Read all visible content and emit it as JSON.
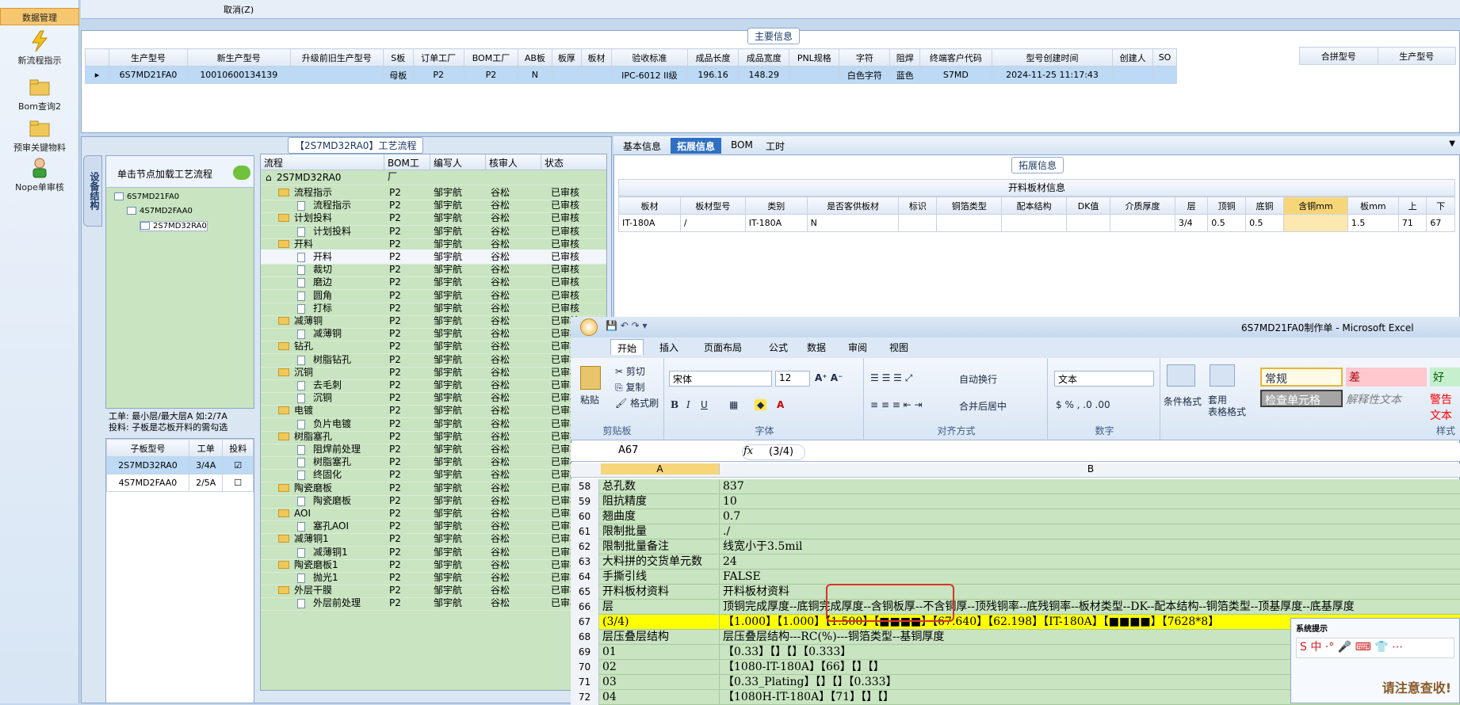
{
  "left_nav": {
    "items": [
      {
        "label": "数据管理",
        "icon": "database-icon",
        "active": true
      },
      {
        "label": "新流程指示",
        "icon": "lightning-icon"
      },
      {
        "label": "Bom查询2",
        "icon": "folder-open-icon"
      },
      {
        "label": "预审关键物料",
        "icon": "folder-open-icon"
      },
      {
        "label": "Nope单审核",
        "icon": "user-icon"
      }
    ]
  },
  "topbar": {
    "cancel_label": "取消(Z)"
  },
  "main_info": {
    "title": "主要信息",
    "columns": [
      "生产型号",
      "新生产型号",
      "升级前旧生产型号",
      "S板",
      "订单工厂",
      "BOM工厂",
      "AB板",
      "板厚",
      "板材",
      "验收标准",
      "成品长度",
      "成品宽度",
      "PNL规格",
      "字符",
      "阻焊",
      "终端客户代码",
      "型号创建时间",
      "创建人",
      "SO"
    ],
    "row": [
      "6S7MD21FA0",
      "10010600134139",
      "",
      "母板",
      "P2",
      "P2",
      "N",
      "",
      "",
      "IPC-6012 II级",
      "196.16",
      "148.29",
      "",
      "白色字符",
      "蓝色",
      "S7MD",
      "2024-11-25 11:17:43",
      "",
      ""
    ],
    "side_columns": [
      "合拼型号",
      "生产型号"
    ]
  },
  "process": {
    "title": "【2S7MD32RA0】工艺流程",
    "vertical_tab": "设备结构",
    "tree_header": "单击节点加载工艺流程",
    "tree_nodes": [
      "6S7MD21FA0",
      "4S7MD2FAA0",
      "2S7MD32RA0"
    ],
    "info_line1": "工单: 最小层/最大层A 如:2/7A",
    "info_line2": "投料: 子板是芯板开料的需勾选",
    "child_columns": [
      "子板型号",
      "工单",
      "投料"
    ],
    "child_rows": [
      {
        "model": "2S7MD32RA0",
        "order": "3/4A",
        "checked": true
      },
      {
        "model": "4S7MD2FAA0",
        "order": "2/5A",
        "checked": false
      }
    ],
    "flow_columns": [
      "流程",
      "BOM工厂",
      "编写人",
      "核审人",
      "状态"
    ],
    "flow_root": "2S7MD32RA0",
    "flow_rows": [
      {
        "name": "流程指示",
        "type": "folder",
        "f": "P2",
        "w": "邹宇航",
        "r": "谷松",
        "s": "已审核"
      },
      {
        "name": "流程指示",
        "type": "doc",
        "f": "P2",
        "w": "邹宇航",
        "r": "谷松",
        "s": "已审核"
      },
      {
        "name": "计划投料",
        "type": "folder",
        "f": "P2",
        "w": "邹宇航",
        "r": "谷松",
        "s": "已审核"
      },
      {
        "name": "计划投料",
        "type": "doc",
        "f": "P2",
        "w": "邹宇航",
        "r": "谷松",
        "s": "已审核"
      },
      {
        "name": "开料",
        "type": "folder",
        "f": "P2",
        "w": "邹宇航",
        "r": "谷松",
        "s": "已审核"
      },
      {
        "name": "开料",
        "type": "doc",
        "f": "P2",
        "w": "邹宇航",
        "r": "谷松",
        "s": "已审核"
      },
      {
        "name": "裁切",
        "type": "doc",
        "f": "P2",
        "w": "邹宇航",
        "r": "谷松",
        "s": "已审核"
      },
      {
        "name": "磨边",
        "type": "doc",
        "f": "P2",
        "w": "邹宇航",
        "r": "谷松",
        "s": "已审核"
      },
      {
        "name": "圆角",
        "type": "doc",
        "f": "P2",
        "w": "邹宇航",
        "r": "谷松",
        "s": "已审核"
      },
      {
        "name": "打标",
        "type": "doc",
        "f": "P2",
        "w": "邹宇航",
        "r": "谷松",
        "s": "已审核"
      },
      {
        "name": "减薄铜",
        "type": "folder",
        "f": "P2",
        "w": "邹宇航",
        "r": "谷松",
        "s": "已审核"
      },
      {
        "name": "减薄铜",
        "type": "doc",
        "f": "P2",
        "w": "邹宇航",
        "r": "谷松",
        "s": "已审核"
      },
      {
        "name": "钻孔",
        "type": "folder",
        "f": "P2",
        "w": "邹宇航",
        "r": "谷松",
        "s": "已审核"
      },
      {
        "name": "树脂钻孔",
        "type": "doc",
        "f": "P2",
        "w": "邹宇航",
        "r": "谷松",
        "s": "已审核"
      },
      {
        "name": "沉铜",
        "type": "folder",
        "f": "P2",
        "w": "邹宇航",
        "r": "谷松",
        "s": "已审核"
      },
      {
        "name": "去毛刺",
        "type": "doc",
        "f": "P2",
        "w": "邹宇航",
        "r": "谷松",
        "s": "已审核"
      },
      {
        "name": "沉铜",
        "type": "doc",
        "f": "P2",
        "w": "邹宇航",
        "r": "谷松",
        "s": "已审核"
      },
      {
        "name": "电镀",
        "type": "folder",
        "f": "P2",
        "w": "邹宇航",
        "r": "谷松",
        "s": "已审核"
      },
      {
        "name": "负片电镀",
        "type": "doc",
        "f": "P2",
        "w": "邹宇航",
        "r": "谷松",
        "s": "已审核"
      },
      {
        "name": "树脂塞孔",
        "type": "folder",
        "f": "P2",
        "w": "邹宇航",
        "r": "谷松",
        "s": "已审核"
      },
      {
        "name": "阻焊前处理",
        "type": "doc",
        "f": "P2",
        "w": "邹宇航",
        "r": "谷松",
        "s": "已审核"
      },
      {
        "name": "树脂塞孔",
        "type": "doc",
        "f": "P2",
        "w": "邹宇航",
        "r": "谷松",
        "s": "已审核"
      },
      {
        "name": "终固化",
        "type": "doc",
        "f": "P2",
        "w": "邹宇航",
        "r": "谷松",
        "s": "已审核"
      },
      {
        "name": "陶瓷磨板",
        "type": "folder",
        "f": "P2",
        "w": "邹宇航",
        "r": "谷松",
        "s": "已审核"
      },
      {
        "name": "陶瓷磨板",
        "type": "doc",
        "f": "P2",
        "w": "邹宇航",
        "r": "谷松",
        "s": "已审核"
      },
      {
        "name": "AOI",
        "type": "folder",
        "f": "P2",
        "w": "邹宇航",
        "r": "谷松",
        "s": "已审核"
      },
      {
        "name": "塞孔AOI",
        "type": "doc",
        "f": "P2",
        "w": "邹宇航",
        "r": "谷松",
        "s": "已审核"
      },
      {
        "name": "减薄铜1",
        "type": "folder",
        "f": "P2",
        "w": "邹宇航",
        "r": "谷松",
        "s": "已审核"
      },
      {
        "name": "减薄铜1",
        "type": "doc",
        "f": "P2",
        "w": "邹宇航",
        "r": "谷松",
        "s": "已审核"
      },
      {
        "name": "陶瓷磨板1",
        "type": "folder",
        "f": "P2",
        "w": "邹宇航",
        "r": "谷松",
        "s": "已审核"
      },
      {
        "name": "抛光1",
        "type": "doc",
        "f": "P2",
        "w": "邹宇航",
        "r": "谷松",
        "s": "已审核"
      },
      {
        "name": "外层干膜",
        "type": "folder",
        "f": "P2",
        "w": "邹宇航",
        "r": "谷松",
        "s": "已审核"
      },
      {
        "name": "外层前处理",
        "type": "doc",
        "f": "P2",
        "w": "邹宇航",
        "r": "谷松",
        "s": "已审核"
      }
    ]
  },
  "ext": {
    "tabs": [
      "基本信息",
      "拓展信息",
      "BOM",
      "工时"
    ],
    "active_tab": "拓展信息",
    "group_title": "拓展信息",
    "table_title": "开料板材信息",
    "columns": [
      "板材",
      "板材型号",
      "类别",
      "是否客供板材",
      "标识",
      "铜箔类型",
      "配本结构",
      "DK值",
      "介质厚度",
      "层",
      "顶铜",
      "底铜",
      "含铜mm",
      "板mm",
      "上",
      "下"
    ],
    "row": [
      "IT-180A",
      "/",
      "IT-180A",
      "N",
      "",
      "",
      "",
      "",
      "",
      "3/4",
      "0.5",
      "0.5",
      "",
      "1.5",
      "71",
      "67"
    ]
  },
  "excel": {
    "title": "6S7MD21FA0制作单 - Microsoft Excel",
    "tabs": [
      "开始",
      "插入",
      "页面布局",
      "公式",
      "数据",
      "审阅",
      "视图"
    ],
    "active_tab": "开始",
    "clipboard": {
      "paste": "粘贴",
      "cut": "剪切",
      "copy": "复制",
      "format_painter": "格式刷",
      "label": "剪贴板"
    },
    "font": {
      "name": "宋体",
      "size": "12",
      "label": "字体"
    },
    "align": {
      "wrap": "自动换行",
      "merge": "合并后居中",
      "label": "对齐方式"
    },
    "number": {
      "format": "文本",
      "label": "数字"
    },
    "styles": {
      "cond": "条件格式",
      "table": "套用\n表格格式",
      "normal": "常规",
      "bad": "差",
      "good": "好",
      "check": "检查单元格",
      "explain": "解释性文本",
      "warn": "警告文本",
      "label": "样式"
    },
    "name_box": "A67",
    "formula": "(3/4)",
    "col_a": "A",
    "col_b": "B",
    "rows": [
      {
        "n": "58",
        "a": "总孔数",
        "b": "837"
      },
      {
        "n": "59",
        "a": "阻抗精度",
        "b": "10"
      },
      {
        "n": "60",
        "a": "翘曲度",
        "b": "0.7"
      },
      {
        "n": "61",
        "a": "限制批量",
        "b": "./"
      },
      {
        "n": "62",
        "a": "限制批量备注",
        "b": "线宽小于3.5mil"
      },
      {
        "n": "63",
        "a": "大料拼的交货单元数",
        "b": "24"
      },
      {
        "n": "64",
        "a": "手撕引线",
        "b": "FALSE"
      },
      {
        "n": "65",
        "a": "开料板材资料",
        "b": "开料板材资料"
      },
      {
        "n": "66",
        "a": "层",
        "b": "顶铜完成厚度--底铜完成厚度--含铜板厚--不含铜厚--顶残铜率--底残铜率--板材类型--DK--配本结构--铜箔类型--顶基厚度--底基厚度"
      },
      {
        "n": "67",
        "a": "(3/4)",
        "b": "【1.000】【1.000】【1.500】【■■■■】【67.640】【62.198】【IT-180A】【■■■■】【7628*8】",
        "highlight": true
      },
      {
        "n": "68",
        "a": "层压叠层结构",
        "b": "层压叠层结构---RC(%)---铜箔类型--基铜厚度"
      },
      {
        "n": "69",
        "a": "01",
        "b": "【0.33】【】【】【0.333】"
      },
      {
        "n": "70",
        "a": "02",
        "b": "【1080-IT-180A】【66】【】【】"
      },
      {
        "n": "71",
        "a": "03",
        "b": "【0.33_Plating】【】【】【0.333】"
      },
      {
        "n": "72",
        "a": "04",
        "b": "【1080H-IT-180A】【71】【】【】"
      }
    ]
  },
  "sogou": {
    "title": "系统提示",
    "tip": "请注意查收!"
  }
}
